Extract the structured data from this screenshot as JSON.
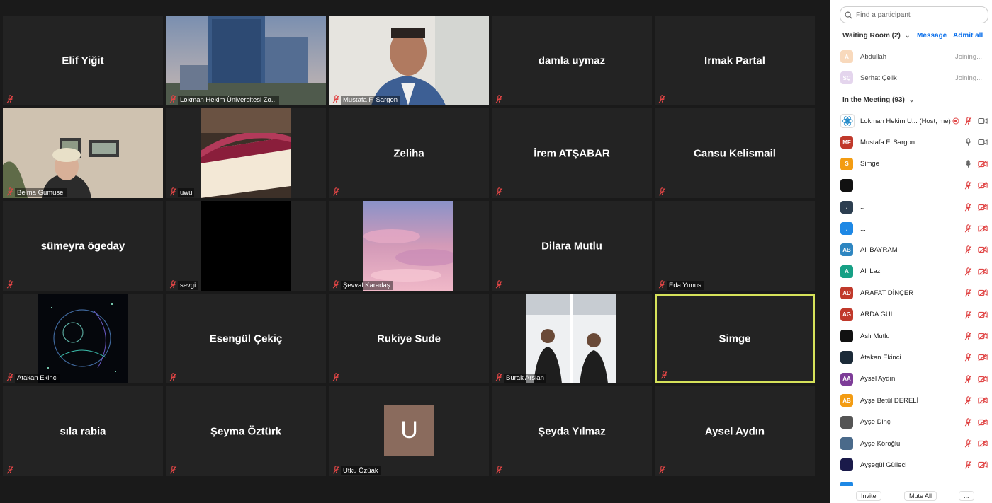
{
  "gallery": {
    "tiles": [
      {
        "name": "Elif Yiğit"
      },
      {
        "caption": "Lokman Hekim Üniversitesi Zo..."
      },
      {
        "caption": "Mustafa F. Sargon"
      },
      {
        "name": "damla uymaz"
      },
      {
        "name": "Irmak Partal"
      },
      {
        "caption": "Belma Gumusel"
      },
      {
        "caption": "uwu"
      },
      {
        "name": "Zeliha"
      },
      {
        "name": "İrem ATŞABAR"
      },
      {
        "name": "Cansu Kelismail"
      },
      {
        "name": "sümeyra ögeday"
      },
      {
        "caption": "sevgi"
      },
      {
        "caption": "Şevval Karadaş"
      },
      {
        "name": "Dilara Mutlu"
      },
      {
        "caption": "Eda Yunus"
      },
      {
        "caption": "Atakan Ekinci"
      },
      {
        "name": "Esengül Çekiç"
      },
      {
        "name": "Rukiye Sude"
      },
      {
        "caption": "Burak Arslan"
      },
      {
        "name": "Simge"
      },
      {
        "name": "sıla rabia"
      },
      {
        "name": "Şeyma Öztürk"
      },
      {
        "caption": "Utku Özüak",
        "avatar_letter": "U"
      },
      {
        "name": "Şeyda Yılmaz"
      },
      {
        "name": "Aysel Aydın"
      }
    ]
  },
  "panel": {
    "search_placeholder": "Find a participant",
    "waiting_room": {
      "label": "Waiting Room (2)",
      "message": "Message",
      "admit_all": "Admit all",
      "people": [
        {
          "initials": "A",
          "name": "Abdullah",
          "status": "Joining...",
          "color": "#f6c9a0"
        },
        {
          "initials": "SÇ",
          "name": "Serhat Çelik",
          "status": "Joining...",
          "color": "#d9c4e6"
        }
      ]
    },
    "in_meeting": {
      "label": "In the Meeting (93)",
      "people": [
        {
          "initials": "",
          "name": "Lokman Hekim U... (Host, me)",
          "color": "#ffffff"
        },
        {
          "initials": "MF",
          "name": "Mustafa F. Sargon",
          "color": "#c0392b"
        },
        {
          "initials": "S",
          "name": "Simge",
          "color": "#f39c12"
        },
        {
          "initials": "",
          "name": ". .",
          "color": "#111111"
        },
        {
          "initials": ".",
          "name": "..",
          "color": "#2c3e50"
        },
        {
          "initials": ".",
          "name": "...",
          "color": "#1e88e5"
        },
        {
          "initials": "AB",
          "name": "Ali BAYRAM",
          "color": "#2e86c1"
        },
        {
          "initials": "A",
          "name": "Ali Laz",
          "color": "#16a085"
        },
        {
          "initials": "AD",
          "name": "ARAFAT DİNÇER",
          "color": "#c0392b"
        },
        {
          "initials": "AG",
          "name": "ARDA GÜL",
          "color": "#c0392b"
        },
        {
          "initials": "",
          "name": "Aslı Mutlu",
          "color": "#111111"
        },
        {
          "initials": "",
          "name": "Atakan Ekinci",
          "color": "#1b2a38"
        },
        {
          "initials": "AA",
          "name": "Aysel Aydın",
          "color": "#7d3c98"
        },
        {
          "initials": "AB",
          "name": "Ayşe Betül DERELİ",
          "color": "#f39c12"
        },
        {
          "initials": "",
          "name": "Ayşe Dinç",
          "color": "#555555"
        },
        {
          "initials": "",
          "name": "Ayşe Köroğlu",
          "color": "#4a6a8a"
        },
        {
          "initials": "",
          "name": "Ayşegül Gülleci",
          "color": "#1a1a4a"
        }
      ]
    },
    "buttons": {
      "invite": "Invite",
      "mute_all": "Mute All",
      "more": "..."
    }
  }
}
